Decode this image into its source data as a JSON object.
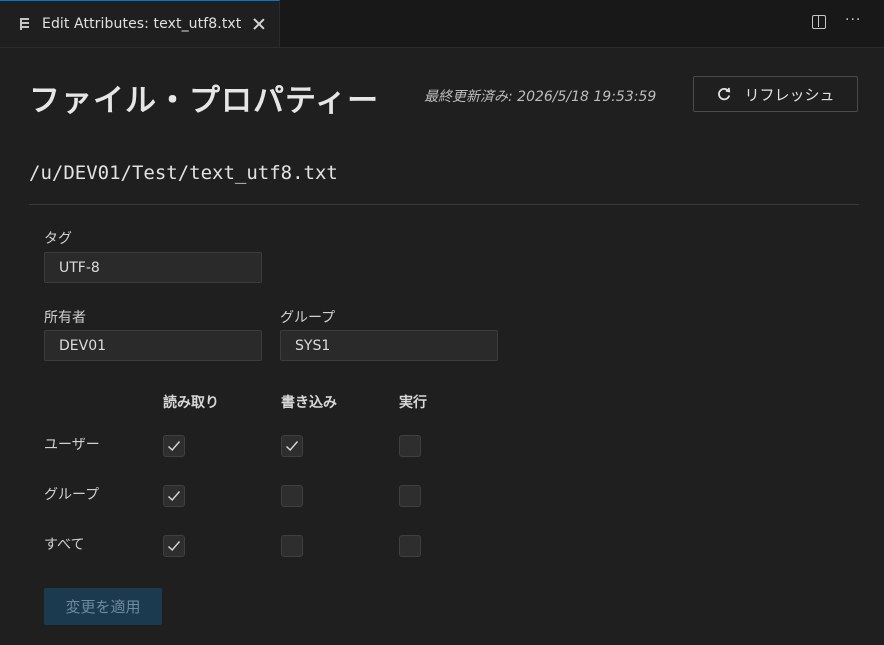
{
  "tab": {
    "title": "Edit Attributes: text_utf8.txt",
    "file_icon": "file-icon",
    "close_icon": "close-icon"
  },
  "toolbar": {
    "split_icon": "split-editor-icon",
    "more_icon": "more-actions-icon",
    "more_glyph": "···"
  },
  "header": {
    "title": "ファイル・プロパティー",
    "last_updated": "最終更新済み: 2026/5/18 19:53:59",
    "refresh_label": "リフレッシュ",
    "refresh_icon": "refresh-icon"
  },
  "file_path": "/u/DEV01/Test/text_utf8.txt",
  "fields": {
    "tag_label": "タグ",
    "tag_value": "UTF-8",
    "owner_label": "所有者",
    "owner_value": "DEV01",
    "group_label": "グループ",
    "group_value": "SYS1"
  },
  "permissions": {
    "columns": [
      "読み取り",
      "書き込み",
      "実行"
    ],
    "rows": [
      {
        "label": "ユーザー",
        "values": [
          true,
          true,
          false
        ]
      },
      {
        "label": "グループ",
        "values": [
          true,
          false,
          false
        ]
      },
      {
        "label": "すべて",
        "values": [
          true,
          false,
          false
        ]
      }
    ]
  },
  "apply_label": "変更を適用",
  "colors": {
    "accent": "#0078d4",
    "background": "#1f1f1f",
    "apply_disabled_bg": "#1c3a4f"
  }
}
